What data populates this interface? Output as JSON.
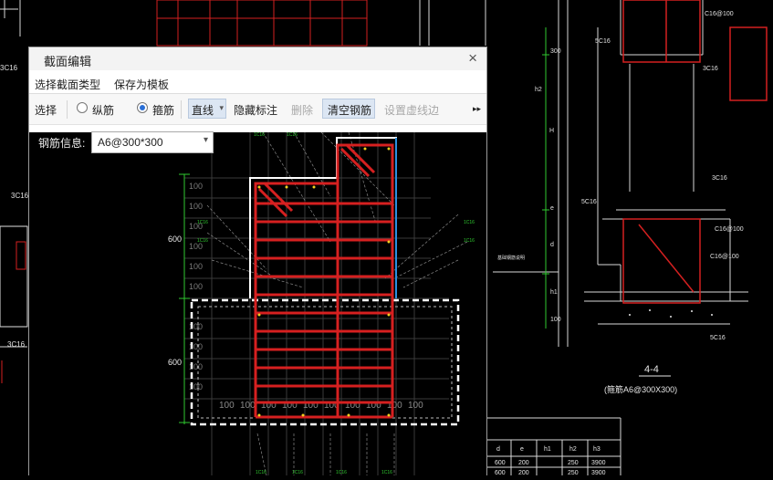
{
  "dialog": {
    "title": "截面编辑",
    "close_label": "×",
    "menu": {
      "select_type": "选择截面类型",
      "save_template": "保存为模板"
    },
    "toolbar": {
      "select": "选择",
      "longitudinal": "纵筋",
      "stirrup": "箍筋",
      "line_mode": "直线",
      "line_mode_caret": "▾",
      "hide_annotation": "隐藏标注",
      "delete": "删除",
      "clear_rebar": "清空钢筋",
      "set_dashed_edge": "设置虚线边",
      "more": "▸▸",
      "selected_radio": "stirrup"
    },
    "rebar_info": {
      "label": "钢筋信息:",
      "value": "A6@300*300",
      "caret": "▾"
    }
  },
  "section_canvas": {
    "dim_upper": "600",
    "dim_lower": "600",
    "grid_label": "100",
    "bottom_labels": [
      "100",
      "100",
      "100",
      "100",
      "100",
      "100",
      "100",
      "100",
      "100",
      "100"
    ],
    "rebar_tag": "1C16"
  },
  "background_cad": {
    "left_labels": [
      "3C16",
      "3C16",
      "3C16"
    ],
    "right_labels": {
      "top_rebar": "C16@100",
      "rebar_5c16_a": "5C16",
      "rebar_3c16_a": "3C16",
      "rebar_3c16_b": "3C16",
      "rebar_5c16_b": "5C16",
      "rebar_c16_100_a": "C16@100",
      "rebar_c16_100_b": "C16@100",
      "rebar_5c16_c": "5C16",
      "dim_300": "300",
      "dim_h2": "h2",
      "dim_h": "H",
      "dim_e": "e",
      "dim_d": "d",
      "dim_h1": "h1",
      "dim_100": "100",
      "section_label": "4-4",
      "section_sub": "(箍筋A6@300X300)",
      "mini_note": "基础钢筋说明"
    },
    "table": {
      "headers": [
        "d",
        "e",
        "h1",
        "h2",
        "h3"
      ],
      "rows": [
        [
          "600",
          "200",
          "",
          "250",
          "3900"
        ],
        [
          "600",
          "200",
          "",
          "250",
          "3900"
        ]
      ]
    }
  },
  "colors": {
    "rebar": "#d62020",
    "grid": "#3a3a3a",
    "cad_white": "#e6e6e6",
    "cad_red": "#d42020",
    "cad_green": "#2fc92f",
    "accent": "#2a6fd6"
  }
}
